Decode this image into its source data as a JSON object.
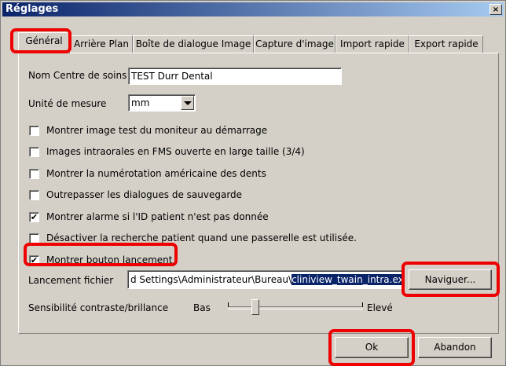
{
  "window": {
    "title": "Réglages",
    "close_glyph": "×",
    "close_icon": "close-icon"
  },
  "tabs": [
    {
      "label": "Général",
      "active": true
    },
    {
      "label": "Arrière Plan",
      "active": false
    },
    {
      "label": "Boîte de dialogue Image",
      "active": false
    },
    {
      "label": "Capture d'image",
      "active": false
    },
    {
      "label": "Import rapide",
      "active": false
    },
    {
      "label": "Export rapide",
      "active": false
    }
  ],
  "general": {
    "centre_label": "Nom Centre de soins",
    "centre_value": "TEST Durr Dental",
    "unit_label": "Unité de mesure",
    "unit_value": "mm",
    "checkboxes": [
      {
        "label": "Montrer image test du moniteur au démarrage",
        "checked": false
      },
      {
        "label": "Images intraorales en FMS ouverte en large taille (3/4)",
        "checked": false
      },
      {
        "label": "Montrer la numérotation américaine des dents",
        "checked": false
      },
      {
        "label": "Outrepasser les dialogues de sauvegarde",
        "checked": false
      },
      {
        "label": "Montrer alarme si l'ID patient n'est pas donnée",
        "checked": true
      },
      {
        "label": "Désactiver la recherche patient quand une passerelle est utilisée.",
        "checked": false
      },
      {
        "label": "Montrer bouton lancement",
        "checked": true
      }
    ],
    "launch_label": "Lancement fichier",
    "launch_value_prefix": "d Settings\\Administrateur\\Bureau\\",
    "launch_value_selected": "cliniview_twain_intra.exe",
    "browse_label": "Naviguer...",
    "contrast_label": "Sensibilité contraste/brillance",
    "contrast_low": "Bas",
    "contrast_high": "Elevé",
    "contrast_level": 0.2
  },
  "buttons": {
    "ok": "Ok",
    "cancel": "Abandon"
  },
  "colors": {
    "highlight": "#e00000",
    "title_bar": "#0a246a",
    "selection": "#0a246a"
  }
}
